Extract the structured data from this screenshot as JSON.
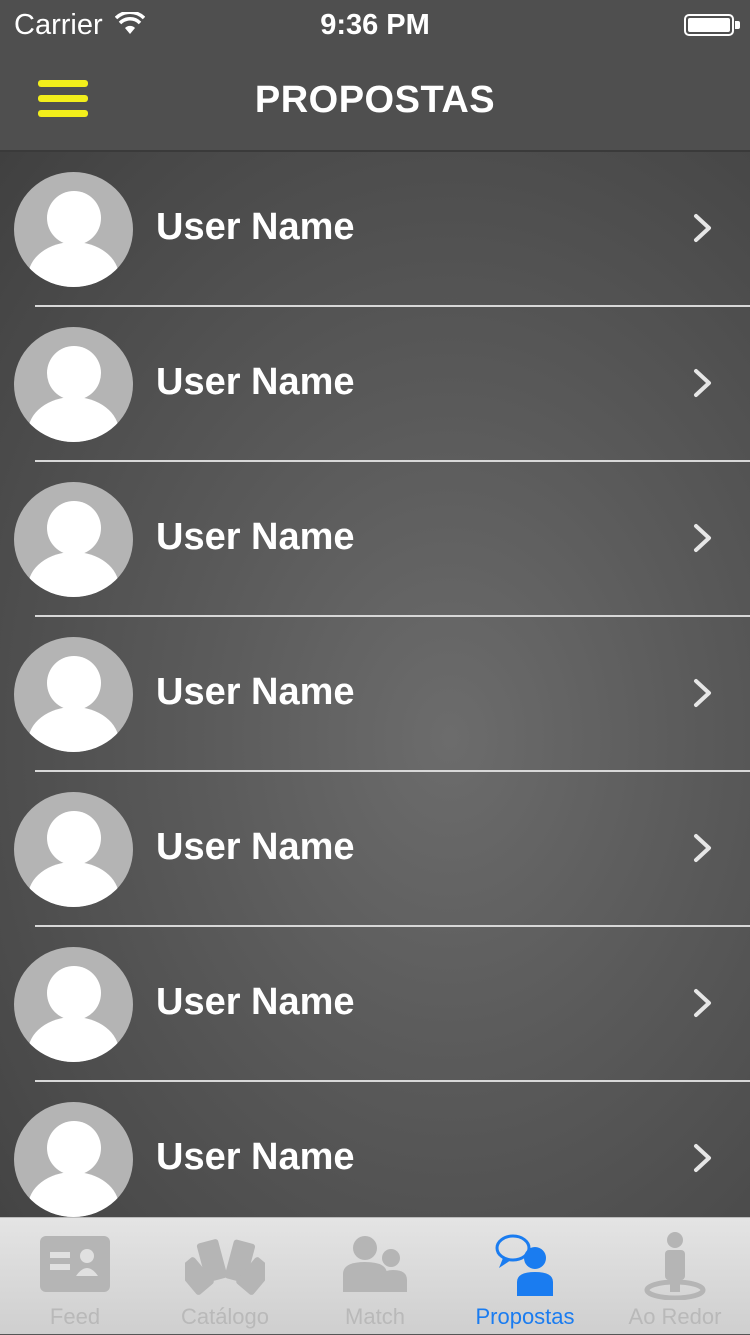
{
  "status_bar": {
    "carrier": "Carrier",
    "time": "9:36 PM"
  },
  "nav": {
    "title": "PROPOSTAS",
    "menu_icon": "hamburger-menu-icon",
    "accent": "#f2ee1b"
  },
  "rows": [
    {
      "name": "User Name"
    },
    {
      "name": "User Name"
    },
    {
      "name": "User Name"
    },
    {
      "name": "User Name"
    },
    {
      "name": "User Name"
    },
    {
      "name": "User Name"
    },
    {
      "name": "User Name"
    }
  ],
  "tabs": [
    {
      "label": "Feed",
      "icon": "feed-card-icon",
      "active": false
    },
    {
      "label": "Catálogo",
      "icon": "catalog-fan-icon",
      "active": false
    },
    {
      "label": "Match",
      "icon": "match-people-icon",
      "active": false
    },
    {
      "label": "Propostas",
      "icon": "proposals-chat-icon",
      "active": true
    },
    {
      "label": "Ao Redor",
      "icon": "nearby-location-icon",
      "active": false
    }
  ],
  "colors": {
    "active_tab": "#1a7cf0",
    "inactive_tab": "#b9b9b9"
  }
}
